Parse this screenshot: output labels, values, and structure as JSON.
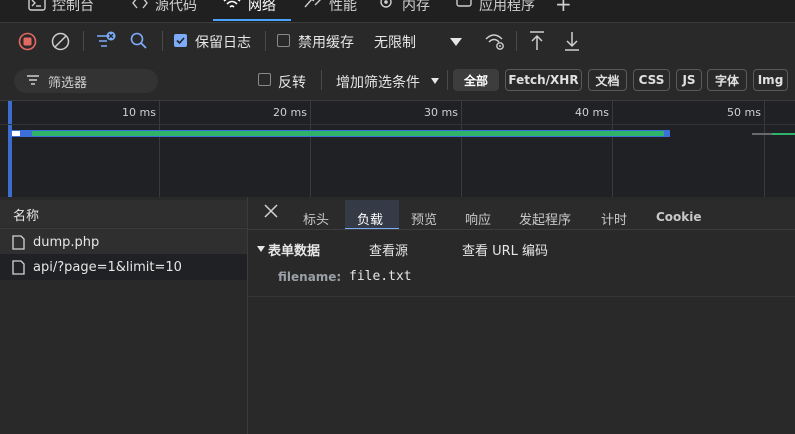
{
  "top_tabs": [
    {
      "label": "控制台",
      "icon": "console-icon"
    },
    {
      "label": "源代码",
      "icon": "sources-icon"
    },
    {
      "label": "网络",
      "icon": "wifi-icon"
    },
    {
      "label": "性能",
      "icon": "performance-icon"
    },
    {
      "label": "内存",
      "icon": "memory-icon"
    },
    {
      "label": "应用程序",
      "icon": "application-icon"
    }
  ],
  "toolbar": {
    "preserve_log_label": "保留日志",
    "preserve_log_checked": true,
    "disable_cache_label": "禁用缓存",
    "disable_cache_checked": false,
    "throttle_label": "无限制"
  },
  "filter": {
    "placeholder": "筛选器",
    "invert_label": "反转",
    "invert_checked": false,
    "more_filters_label": "增加筛选条件",
    "types": [
      "全部",
      "Fetch/XHR",
      "文档",
      "CSS",
      "JS",
      "字体",
      "Img"
    ],
    "active_type": "全部"
  },
  "timeline": {
    "ticks": [
      "10 ms",
      "20 ms",
      "30 ms",
      "40 ms",
      "50 ms"
    ],
    "colors": {
      "bar": "#2fb36b",
      "edge": "#3b6fd9",
      "waiting": "#ffffff"
    }
  },
  "requests": {
    "header": "名称",
    "items": [
      "dump.php",
      "api/?page=1&limit=10"
    ],
    "selected_index": 0
  },
  "details": {
    "tabs": [
      "标头",
      "负载",
      "预览",
      "响应",
      "发起程序",
      "计时",
      "Cookie"
    ],
    "active_tab": "负载",
    "section_title": "表单数据",
    "view_source": "查看源",
    "view_url_encoded": "查看 URL 编码",
    "fields": [
      {
        "key": "filename:",
        "value": "file.txt"
      }
    ]
  },
  "colors": {
    "accent": "#7cacf8",
    "stop_red": "#e46962",
    "background": "#292929"
  }
}
